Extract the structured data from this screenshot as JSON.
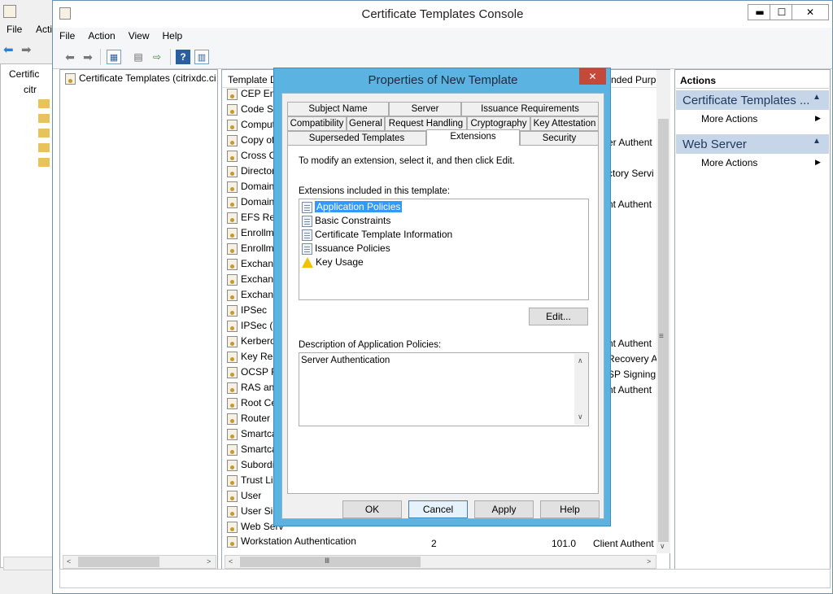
{
  "background_window": {
    "menu": [
      "File",
      "Acti"
    ],
    "tree_label": "Certific",
    "tree_sub": "citr"
  },
  "window": {
    "title": "Certificate Templates Console",
    "controls": {
      "minimize": "▬",
      "maximize": "☐",
      "close": "✕"
    }
  },
  "menu": [
    "File",
    "Action",
    "View",
    "Help"
  ],
  "tree": {
    "root_label": "Certificate Templates (citrixdc.ci"
  },
  "list": {
    "col_template": "Template D",
    "col_purpose": "nded Purpo",
    "rows": [
      {
        "name": "CEP Enc",
        "purpose": ""
      },
      {
        "name": "Code Si",
        "purpose": ""
      },
      {
        "name": "Comput",
        "purpose": ""
      },
      {
        "name": "Copy of",
        "purpose": "er Authent"
      },
      {
        "name": "Cross C",
        "purpose": ""
      },
      {
        "name": "Director",
        "purpose": "ctory Servi"
      },
      {
        "name": "Domain",
        "purpose": ""
      },
      {
        "name": "Domain",
        "purpose": "nt Authent"
      },
      {
        "name": "EFS Rec",
        "purpose": ""
      },
      {
        "name": "Enrollm",
        "purpose": ""
      },
      {
        "name": "Enrollm",
        "purpose": ""
      },
      {
        "name": "Exchang",
        "purpose": ""
      },
      {
        "name": "Exchang",
        "purpose": ""
      },
      {
        "name": "Exchang",
        "purpose": ""
      },
      {
        "name": "IPSec",
        "purpose": ""
      },
      {
        "name": "IPSec (O",
        "purpose": ""
      },
      {
        "name": "Kerbero",
        "purpose": "nt Authent"
      },
      {
        "name": "Key Rec",
        "purpose": "Recovery A"
      },
      {
        "name": "OCSP Re",
        "purpose": "SP Signing"
      },
      {
        "name": "RAS and",
        "purpose": "nt Authent"
      },
      {
        "name": "Root Ce",
        "purpose": ""
      },
      {
        "name": "Router (",
        "purpose": ""
      },
      {
        "name": "Smartca",
        "purpose": ""
      },
      {
        "name": "Smartca",
        "purpose": ""
      },
      {
        "name": "Subordi",
        "purpose": ""
      },
      {
        "name": "Trust Lis",
        "purpose": ""
      },
      {
        "name": "User",
        "purpose": ""
      },
      {
        "name": "User Sig",
        "purpose": ""
      },
      {
        "name": "Web Serv",
        "purpose": ""
      }
    ],
    "last_row": {
      "name": "Workstation Authentication",
      "version": "2",
      "minor": "101.0",
      "purpose": "Client Authent"
    }
  },
  "actions": {
    "title": "Actions",
    "groups": [
      {
        "header": "Certificate Templates ...",
        "item": "More Actions"
      },
      {
        "header": "Web Server",
        "item": "More Actions"
      }
    ]
  },
  "dialog": {
    "title": "Properties of New Template",
    "close": "✕",
    "tabs_row1": [
      "Subject Name",
      "Server",
      "Issuance Requirements"
    ],
    "tabs_row2": [
      "Compatibility",
      "General",
      "Request Handling",
      "Cryptography",
      "Key Attestation"
    ],
    "tabs_row3": [
      "Superseded Templates",
      "Extensions",
      "Security"
    ],
    "instruction": "To modify an extension, select it, and then click Edit.",
    "extensions_label": "Extensions included in this template:",
    "extensions": [
      "Application Policies",
      "Basic Constraints",
      "Certificate Template Information",
      "Issuance Policies",
      "Key Usage"
    ],
    "edit_button": "Edit...",
    "description_label": "Description of Application Policies:",
    "description_text": "Server Authentication",
    "buttons": {
      "ok": "OK",
      "cancel": "Cancel",
      "apply": "Apply",
      "help": "Help"
    }
  }
}
